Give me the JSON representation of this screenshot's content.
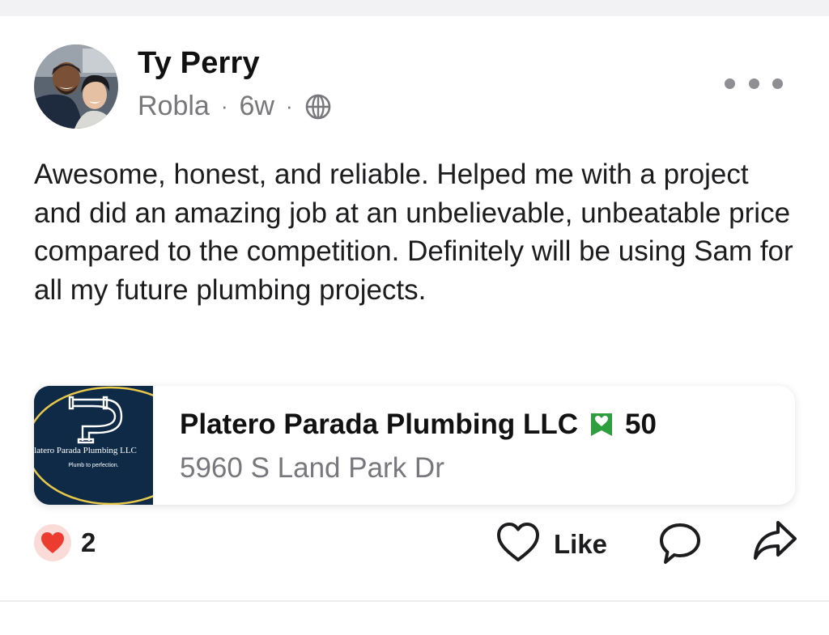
{
  "post": {
    "author": {
      "name": "Ty Perry",
      "location": "Robla",
      "separator": "·",
      "age": "6w",
      "visibility_icon": "globe-icon"
    },
    "more_icon": "more-options-icon",
    "text": "Awesome, honest, and reliable. Helped me with a project and did an amazing job at an unbelievable, unbeatable price compared to the competition. Definitely will be using Sam for all my future plumbing projects.",
    "business": {
      "name": "Platero Parada Plumbing LLC",
      "badge_icon": "neighborhood-fave-badge-icon",
      "badge_color": "#2e9e3f",
      "badge_count": "50",
      "address": "5960 S Land Park Dr",
      "logo": {
        "name_text": "Platero Parada Plumbing LLC",
        "tagline": "Plumb to perfection.",
        "background": "#0f2a47",
        "ring_color": "#e8c84a"
      }
    },
    "reactions": {
      "icon": "heart-reaction-icon",
      "count": "2"
    },
    "actions": {
      "like_label": "Like",
      "like_icon": "heart-outline-icon",
      "comment_icon": "comment-bubble-icon",
      "share_icon": "share-arrow-icon"
    }
  }
}
